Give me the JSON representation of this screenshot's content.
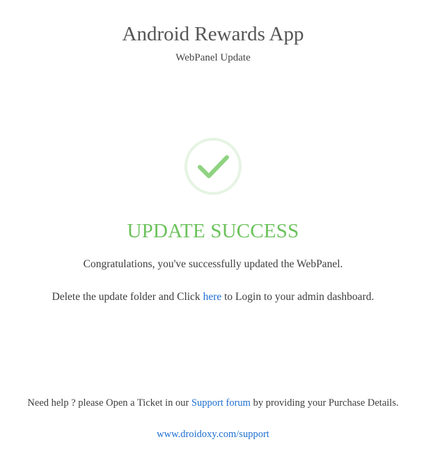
{
  "header": {
    "title": "Android Rewards App",
    "subtitle": "WebPanel Update"
  },
  "status": {
    "icon": "checkmark-circle-icon",
    "text": "UPDATE SUCCESS",
    "color": "#6cc25d"
  },
  "messages": {
    "congrats": "Congratulations, you've successfully updated the WebPanel.",
    "delete_before": "Delete the update folder and Click ",
    "here_link": "here",
    "delete_after": " to Login to your admin dashboard."
  },
  "footer": {
    "help_before": "Need help ? please Open a Ticket in our ",
    "support_link": "Support forum",
    "help_after": " by providing your Purchase Details.",
    "site_link": "www.droidoxy.com/support"
  },
  "colors": {
    "link": "#1e6fd0",
    "check_ring": "#e6f4e3",
    "check_mark": "#8fd380"
  }
}
